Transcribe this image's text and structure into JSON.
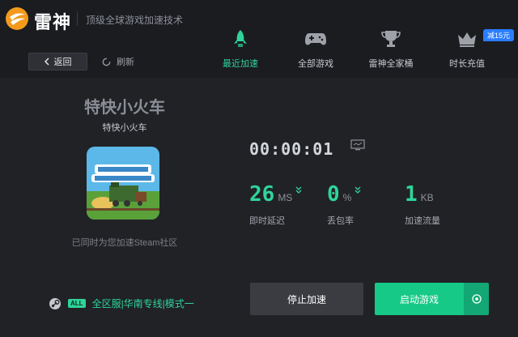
{
  "header": {
    "brand": "雷神",
    "tagline": "顶级全球游戏加速技术"
  },
  "toolbar": {
    "back_label": "返回",
    "refresh_label": "刷新"
  },
  "nav": [
    {
      "label": "最近加速",
      "icon": "rocket-icon",
      "active": true
    },
    {
      "label": "全部游戏",
      "icon": "gamepad-icon",
      "active": false
    },
    {
      "label": "雷神全家桶",
      "icon": "trophy-icon",
      "active": false
    },
    {
      "label": "时长充值",
      "icon": "crown-icon",
      "active": false
    }
  ],
  "promo_badge": "减15元",
  "game": {
    "title": "特快小火车",
    "subtitle": "特快小火车",
    "steam_note": "已同时为您加速Steam社区"
  },
  "session": {
    "timer": "00:00:01"
  },
  "stats": [
    {
      "value": "26",
      "unit": "MS",
      "label": "即时延迟"
    },
    {
      "value": "0",
      "unit": "%",
      "label": "丢包率"
    },
    {
      "value": "1",
      "unit": "KB",
      "label": "加速流量"
    }
  ],
  "region": {
    "tag": "ALL",
    "text": "全区服|华南专线|模式一"
  },
  "actions": {
    "stop_label": "停止加速",
    "start_label": "启动游戏"
  },
  "colors": {
    "accent": "#2fd49a",
    "start_button": "#16c987",
    "badge": "#2a7dff",
    "background": "#212226",
    "header": "#1b1c20"
  }
}
